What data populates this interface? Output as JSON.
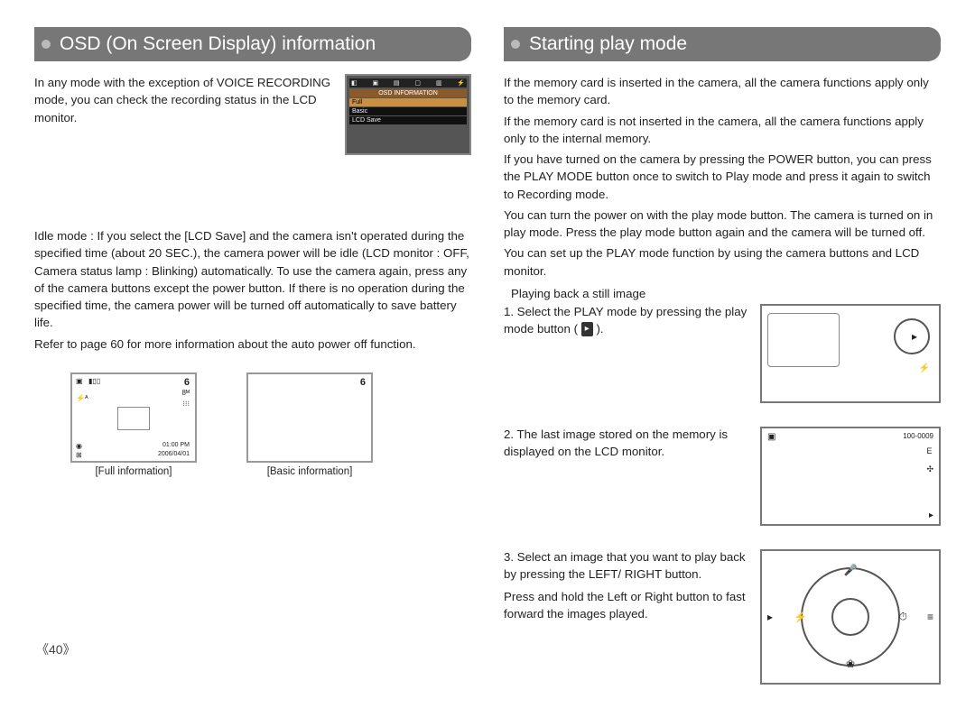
{
  "left": {
    "header": "OSD (On Screen Display) information",
    "intro": "In any mode with the exception of VOICE RECORDING mode, you can check the recording status in the LCD monitor.",
    "lcd_menu": {
      "title": "OSD INFORMATION",
      "items": [
        "Full",
        "Basic",
        "LCD Save"
      ]
    },
    "idle": "Idle mode : If you select the [LCD Save] and the camera isn't operated during the specified time (about 20 SEC.), the camera power will be idle (LCD monitor : OFF, Camera status lamp : Blinking) automatically. To use the camera again, press any of the camera buttons except the power button. If there is no operation during the specified time, the camera power will be turned off automatically to save battery life.",
    "ref": "Refer to page 60 for more information about the auto power off function.",
    "full_info": {
      "caption": "[Full information]",
      "num": "6",
      "time": "01:00 PM",
      "date": "2006/04/01",
      "flash": "⚡ᴬ",
      "bat": "▮▯▯",
      "tl": "▣",
      "bl1": "◉",
      "bl2": "⊞",
      "r1": "8ᴹ",
      "r2": "⁝⁝⁝"
    },
    "basic_info": {
      "caption": "[Basic information]",
      "num": "6"
    }
  },
  "right": {
    "header": "Starting play mode",
    "p1": "If the memory card is inserted in the camera, all the camera functions apply only to the memory card.",
    "p2": "If the memory card is not inserted in the camera, all the camera functions apply only to the internal memory.",
    "p3": "If you have turned on the camera by pressing the POWER button, you can press the PLAY MODE button once to switch to Play mode and press it again to switch to Recording mode.",
    "p4": "You can turn the power on with the play mode button. The camera is turned on in play mode. Press the play mode button again and the camera will be turned off.",
    "p5": "You can set up the PLAY mode function by using the camera buttons and LCD monitor.",
    "subhead": "Playing back a still image",
    "s1a": "1. Select the PLAY mode by pressing the play mode button ( ",
    "s1b": " ).",
    "s2": "2. The last image stored on the memory is displayed on the LCD monitor.",
    "s3": "3. Select an image that you want to play back by pressing the LEFT/ RIGHT button.",
    "s3note": "Press and hold the Left or Right button to fast forward the images played.",
    "fig1": {
      "play_icon": "▸",
      "flash": "⚡"
    },
    "fig2": {
      "tl": "▣",
      "tr": "100-0009",
      "e": "E",
      "mid": "✣",
      "play": "▸"
    },
    "fig3": {
      "up": "🎤",
      "dn": "❀",
      "lf": "⚡",
      "rt": "⏱",
      "bars": "≡",
      "play": "▸"
    }
  },
  "page": "《40》"
}
